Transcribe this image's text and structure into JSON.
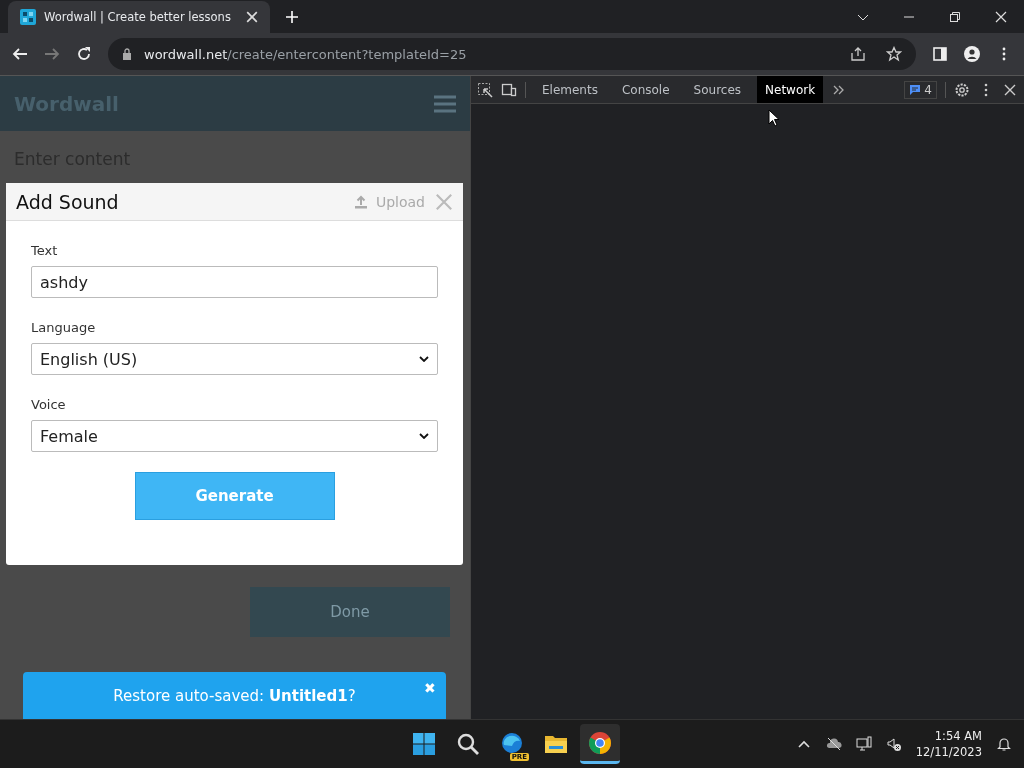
{
  "browser": {
    "tab": {
      "title": "Wordwall | Create better lessons"
    },
    "url": {
      "host": "wordwall.net",
      "path": "/create/entercontent?templateId=25"
    }
  },
  "page": {
    "logo": "Wordwall",
    "heading": "Enter content",
    "done_button": "Done",
    "dialog": {
      "title": "Add Sound",
      "upload": "Upload",
      "fields": [
        {
          "kind": "text",
          "label": "Text",
          "value": "ashdy"
        },
        {
          "kind": "select",
          "label": "Language",
          "value": "English (US)"
        },
        {
          "kind": "select",
          "label": "Voice",
          "value": "Female"
        }
      ],
      "generate_button": "Generate"
    },
    "toast": {
      "text": "Restore auto-saved: **Untitled1**?",
      "close": "✖"
    }
  },
  "devtools": {
    "tabs": [
      {
        "label": "Elements",
        "selected": false
      },
      {
        "label": "Console",
        "selected": false
      },
      {
        "label": "Sources",
        "selected": false
      },
      {
        "label": "Network",
        "selected": true
      }
    ],
    "issues_count": "4"
  },
  "taskbar": {
    "apps": [
      {
        "kind": "start"
      },
      {
        "kind": "search"
      },
      {
        "kind": "edge",
        "badge": "PRE"
      },
      {
        "kind": "folder"
      },
      {
        "kind": "chrome",
        "selected": true
      }
    ],
    "time": "1:54 AM",
    "date": "12/11/2023"
  }
}
